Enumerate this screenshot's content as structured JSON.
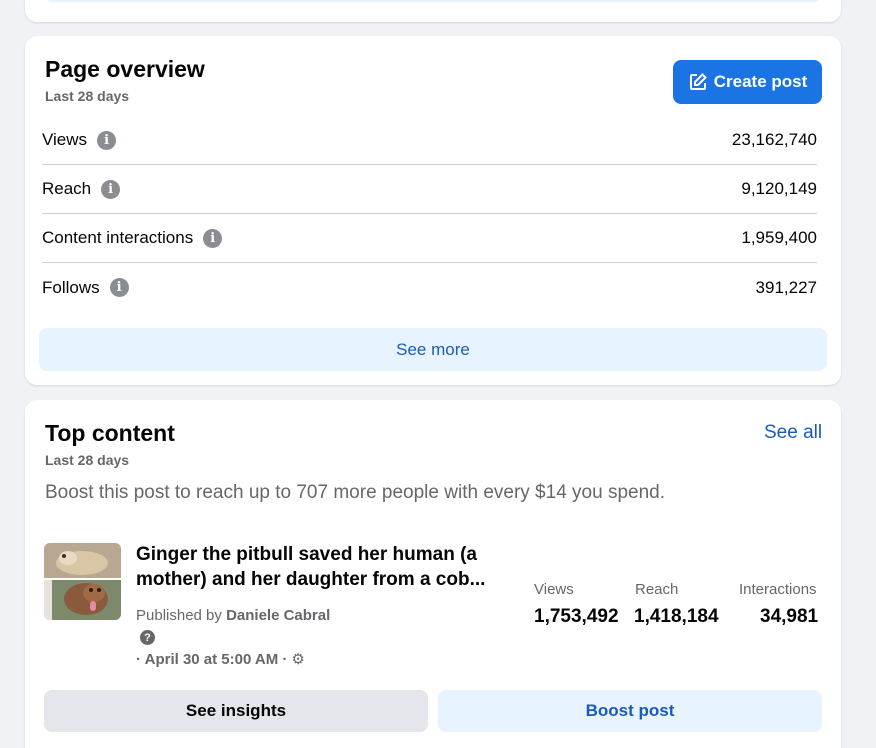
{
  "overview": {
    "title": "Page overview",
    "period": "Last 28 days",
    "create_post_label": "Create post",
    "metrics": [
      {
        "label": "Views",
        "value": "23,162,740"
      },
      {
        "label": "Reach",
        "value": "9,120,149"
      },
      {
        "label": "Content interactions",
        "value": "1,959,400"
      },
      {
        "label": "Follows",
        "value": "391,227"
      }
    ],
    "see_more_label": "See more"
  },
  "top_content": {
    "title": "Top content",
    "period": "Last 28 days",
    "see_all_label": "See all",
    "boost_message": "Boost this post to reach up to 707 more people with every $14 you spend.",
    "post": {
      "title": "Ginger the pitbull saved her human (a mother) and her daughter from a cob...",
      "published_prefix": "Published by ",
      "author": "Daniele Cabral",
      "date": "· April 30 at 5:00 AM ·",
      "stats": {
        "views_label": "Views",
        "views": "1,753,492",
        "reach_label": "Reach",
        "reach": "1,418,184",
        "interactions_label": "Interactions",
        "interactions": "34,981"
      }
    },
    "see_insights_label": "See insights",
    "boost_post_label": "Boost post"
  },
  "colors": {
    "accent": "#1b74e4",
    "link": "#1a5bb8",
    "secondary_text": "#65676b",
    "page_bg": "#f0f2f5"
  }
}
